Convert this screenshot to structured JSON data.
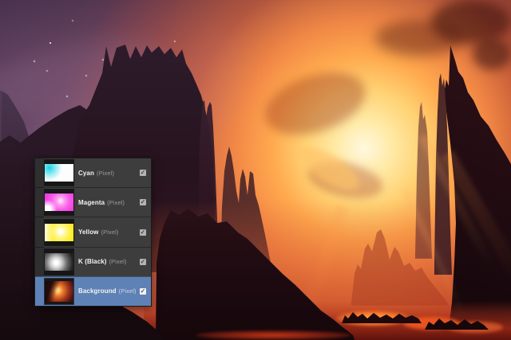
{
  "layers_panel": {
    "rows": [
      {
        "name": "Cyan",
        "kind": "(Pixel)",
        "check_glyph": "✓",
        "selected": false
      },
      {
        "name": "Magenta",
        "kind": "(Pixel)",
        "check_glyph": "✓",
        "selected": false
      },
      {
        "name": "Yellow",
        "kind": "(Pixel)",
        "check_glyph": "✓",
        "selected": false
      },
      {
        "name": "K (Black)",
        "kind": "(Pixel)",
        "check_glyph": "✓",
        "selected": false
      },
      {
        "name": "Background",
        "kind": "(Pixel)",
        "check_glyph": "✓",
        "selected": true
      }
    ],
    "colors": {
      "row_background": "#3d3d3d",
      "gutter": "#2f2f2f",
      "selected_row_background": "#5e82b5",
      "name_text": "#f2f2f2",
      "kind_text": "#9b9b9b"
    }
  },
  "scene": {
    "palette": {
      "sun_core": "#fff8e0",
      "sun_glow": "#ffa94e",
      "sky_purple": "#6f5270",
      "sky_red": "#8c3322",
      "silhouette_rock": "#241320",
      "lava": "#ff7a28",
      "haze": "#d65c30"
    }
  }
}
